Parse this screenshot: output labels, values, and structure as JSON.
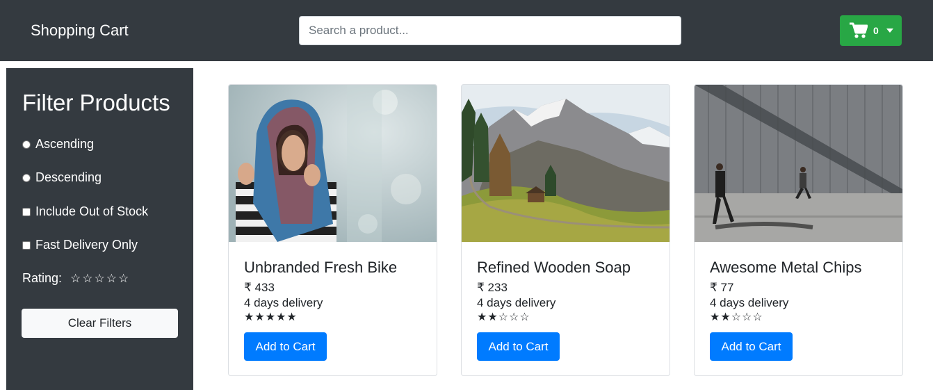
{
  "navbar": {
    "brand": "Shopping Cart",
    "search_placeholder": "Search a product...",
    "cart_count": "0",
    "colors": {
      "bg": "#343a40",
      "cart_button": "#28a745"
    }
  },
  "sidebar": {
    "title": "Filter Products",
    "options": [
      {
        "label": "Ascending",
        "type": "radio"
      },
      {
        "label": "Descending",
        "type": "radio"
      },
      {
        "label": "Include Out of Stock",
        "type": "checkbox"
      },
      {
        "label": "Fast Delivery Only",
        "type": "checkbox"
      }
    ],
    "rating_label": "Rating:",
    "rating_value": 0,
    "rating_max": 5,
    "clear_label": "Clear Filters"
  },
  "products": [
    {
      "title": "Unbranded Fresh Bike",
      "price": "₹ 433",
      "delivery": "4 days delivery",
      "rating": 5,
      "button": "Add to Cart",
      "image": "woman-scarf-photo"
    },
    {
      "title": "Refined Wooden Soap",
      "price": "₹ 233",
      "delivery": "4 days delivery",
      "rating": 2,
      "button": "Add to Cart",
      "image": "mountain-valley-photo"
    },
    {
      "title": "Awesome Metal Chips",
      "price": "₹ 77",
      "delivery": "4 days delivery",
      "rating": 2,
      "button": "Add to Cart",
      "image": "men-walking-wall-photo"
    }
  ],
  "colors": {
    "primary": "#007bff",
    "sidebar_bg": "#343a40"
  }
}
